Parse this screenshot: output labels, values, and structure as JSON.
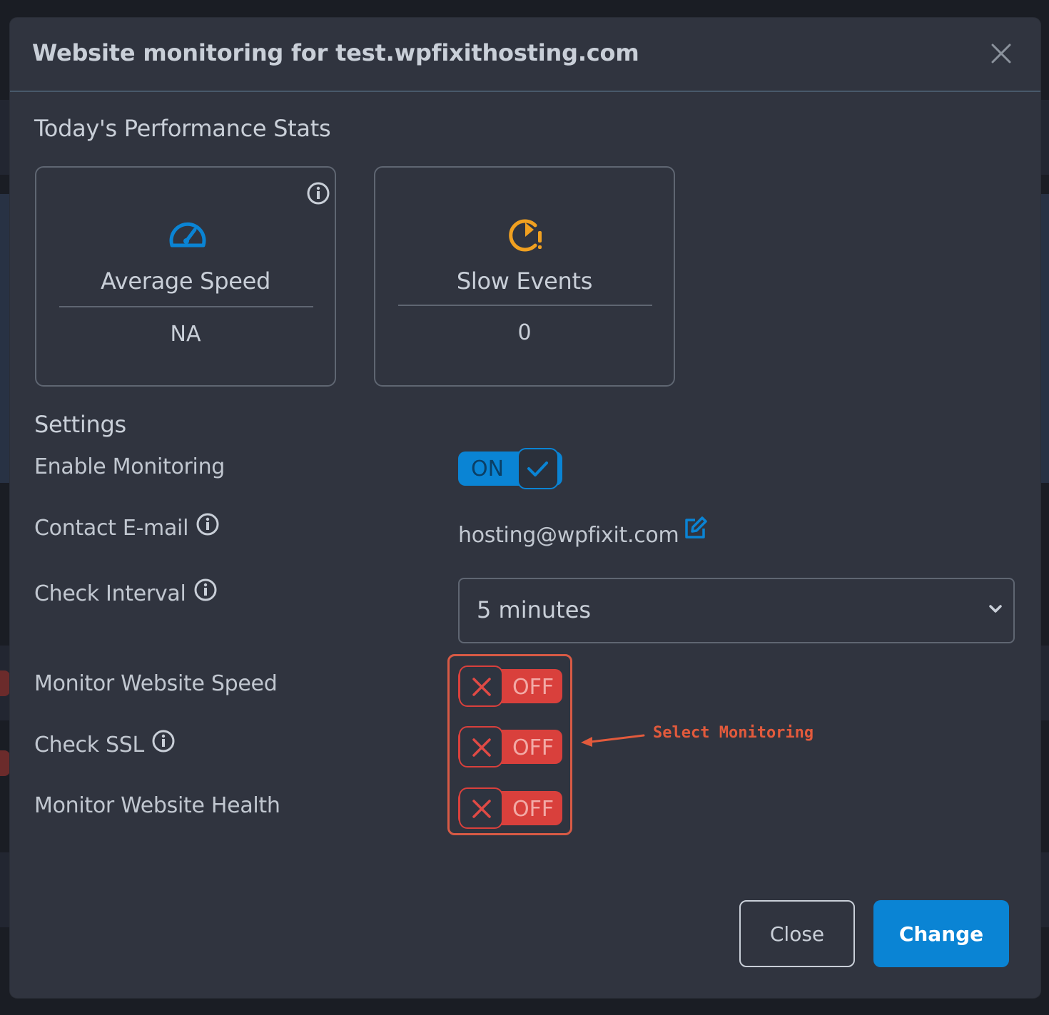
{
  "modal": {
    "title": "Website monitoring for test.wpfixithosting.com"
  },
  "performance": {
    "heading": "Today's Performance Stats",
    "cards": [
      {
        "label": "Average Speed",
        "value": "NA",
        "icon": "speedometer-icon",
        "icon_color": "#0a84d4"
      },
      {
        "label": "Slow Events",
        "value": "0",
        "icon": "slow-clock-warning-icon",
        "icon_color": "#f0a020"
      }
    ]
  },
  "settings": {
    "heading": "Settings",
    "enable_monitoring": {
      "label": "Enable Monitoring",
      "state": "ON",
      "on": true
    },
    "contact_email": {
      "label": "Contact E-mail",
      "value": "hosting@wpfixit.com"
    },
    "check_interval": {
      "label": "Check Interval",
      "selected": "5 minutes"
    },
    "toggles": [
      {
        "label": "Monitor Website Speed",
        "state": "OFF",
        "on": false
      },
      {
        "label": "Check SSL",
        "state": "OFF",
        "on": false
      },
      {
        "label": "Monitor Website Health",
        "state": "OFF",
        "on": false
      }
    ]
  },
  "annotation": {
    "text": "Select Monitoring",
    "color": "#e25a3c"
  },
  "footer": {
    "close_label": "Close",
    "change_label": "Change"
  },
  "colors": {
    "accent": "#0a84d4",
    "danger": "#d9403c",
    "modal_bg": "#30343f"
  }
}
